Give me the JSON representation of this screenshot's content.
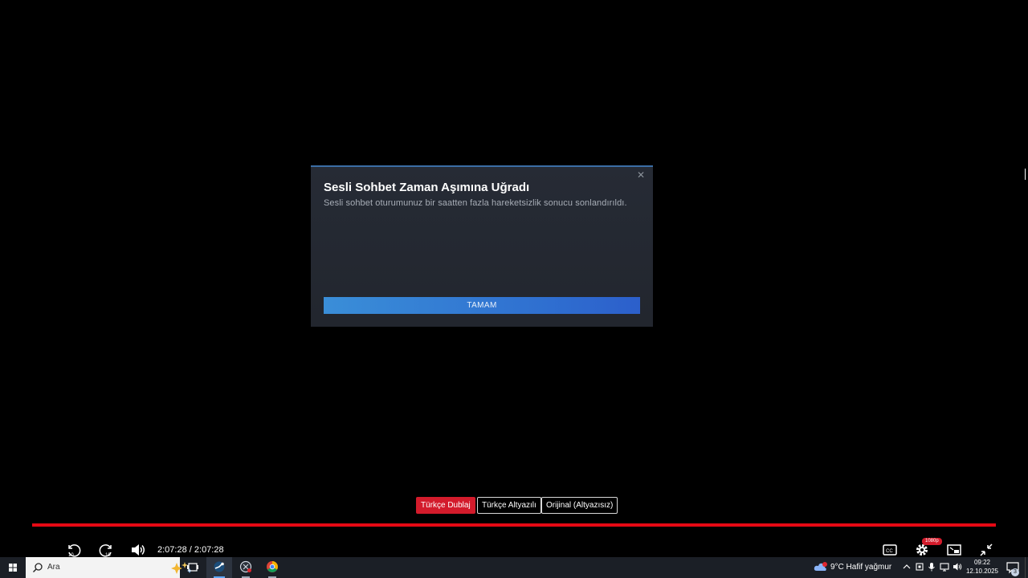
{
  "dialog": {
    "title": "Sesli Sohbet Zaman Aşımına Uğradı",
    "message": "Sesli sohbet oturumunuz bir saatten fazla hareketsizlik sonucu sonlandırıldı.",
    "ok_label": "TAMAM",
    "close_glyph": "✕",
    "accent_color": "#3a8ed8"
  },
  "player": {
    "audio_options": [
      {
        "label": "Türkçe Dublaj",
        "active": true
      },
      {
        "label": "Türkçe Altyazılı",
        "active": false
      },
      {
        "label": "Orijinal (Altyazısız)",
        "active": false
      }
    ],
    "progress_fraction": 1.0,
    "current_time": "2:07:28",
    "duration": "2:07:28",
    "time_separator": "/",
    "quality_badge": "1080p",
    "controls": [
      "rewind-10-icon",
      "forward-10-icon",
      "volume-icon",
      "captions-icon",
      "settings-icon",
      "picture-in-picture-icon",
      "exit-fullscreen-icon"
    ],
    "accent_color": "#e50914"
  },
  "taskbar": {
    "search_placeholder": "Ara",
    "apps": [
      "task-view-icon",
      "steam-icon",
      "app-icon",
      "chrome-icon"
    ],
    "weather_text": "9°C  Hafif yağmur",
    "clock_time": "09:22",
    "clock_date": "12.10.2025",
    "notification_count": "3"
  }
}
